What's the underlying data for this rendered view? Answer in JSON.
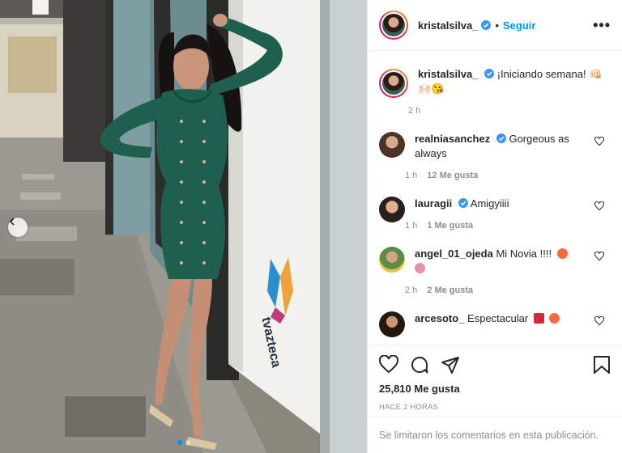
{
  "post": {
    "username": "kristalsilva_",
    "follow_label": "Seguir",
    "more_label": "•••",
    "caption": "¡Iniciando semana! 👊🏻 🙌🏻😘",
    "caption_time": "2 h",
    "likes": "25,810 Me gusta",
    "timestamp": "HACE 2 HORAS",
    "comments_limited": "Se limitaron los comentarios en esta publicación."
  },
  "comments": [
    {
      "username": "realniasanchez",
      "verified": true,
      "text": "Gorgeous as always",
      "time": "1 h",
      "likes": "12 Me gusta"
    },
    {
      "username": "lauragii",
      "verified": true,
      "text": "Amigyiiii",
      "time": "1 h",
      "likes": "1 Me gusta"
    },
    {
      "username": "angel_01_ojeda",
      "verified": false,
      "text": "Mi Novia !!!!",
      "time": "2 h",
      "likes": "2 Me gusta"
    },
    {
      "username": "arcesoto_",
      "verified": false,
      "text": "Espectacular",
      "time": "",
      "likes": ""
    }
  ],
  "photo": {
    "logo_text": "tvazteca"
  },
  "colors": {
    "accent": "#0095f6",
    "dress": "#1f5f4f",
    "text": "#262626",
    "muted": "#8e8e8e"
  },
  "icons": [
    "verified-icon",
    "heart-icon",
    "comment-icon",
    "share-icon",
    "bookmark-icon",
    "chevron-left-icon",
    "more-icon"
  ]
}
